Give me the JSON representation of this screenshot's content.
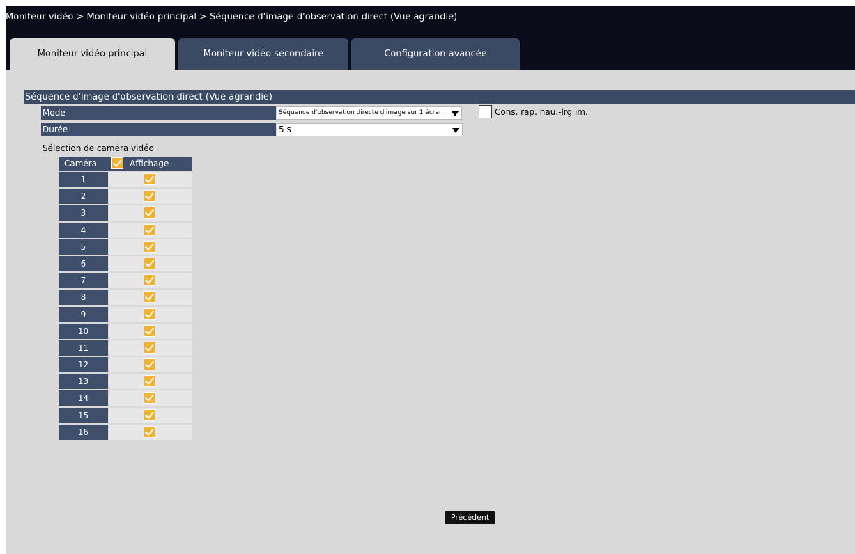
{
  "breadcrumb": "Moniteur vidéo > Moniteur vidéo principal > Séquence d'image d'observation direct (Vue agrandie)",
  "tabs": [
    {
      "label": "Moniteur vidéo principal",
      "active": true
    },
    {
      "label": "Moniteur vidéo secondaire",
      "active": false
    },
    {
      "label": "Configuration avancée",
      "active": false
    }
  ],
  "section_title": "Séquence d'image d'observation direct (Vue agrandie)",
  "mode": {
    "label": "Mode",
    "value": "Séquence d'observation directe d'image sur 1 écran"
  },
  "duration": {
    "label": "Durée",
    "value": "5 s"
  },
  "aspect_option": {
    "label": "Cons. rap. hau.-lrg im.",
    "checked": false
  },
  "camera_selection": {
    "label": "Sélection de caméra vidéo",
    "col_camera": "Caméra",
    "col_display": "Affichage",
    "all_checked": true,
    "cameras": [
      {
        "number": "1",
        "checked": true
      },
      {
        "number": "2",
        "checked": true
      },
      {
        "number": "3",
        "checked": true
      },
      {
        "number": "4",
        "checked": true
      },
      {
        "number": "5",
        "checked": true
      },
      {
        "number": "6",
        "checked": true
      },
      {
        "number": "7",
        "checked": true
      },
      {
        "number": "8",
        "checked": true
      },
      {
        "number": "9",
        "checked": true
      },
      {
        "number": "10",
        "checked": true
      },
      {
        "number": "11",
        "checked": true
      },
      {
        "number": "12",
        "checked": true
      },
      {
        "number": "13",
        "checked": true
      },
      {
        "number": "14",
        "checked": true
      },
      {
        "number": "15",
        "checked": true
      },
      {
        "number": "16",
        "checked": true
      }
    ]
  },
  "buttons": {
    "previous": "Précédent"
  },
  "colors": {
    "titlebar_bg": "#0a0d19",
    "header_bg": "#3a4a64",
    "panel_bg": "#d9d9d9",
    "checkbox_checked": "#f4b12b"
  }
}
